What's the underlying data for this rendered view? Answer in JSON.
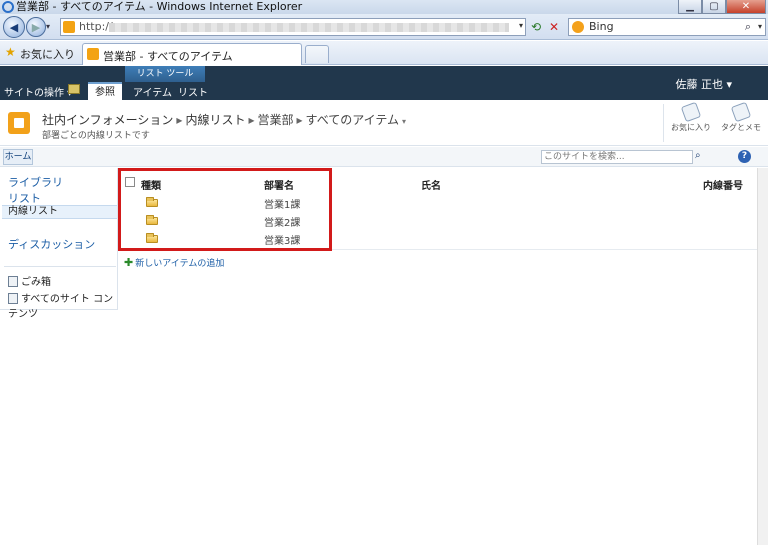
{
  "browser": {
    "window_title": "営業部 - すべてのアイテム - Windows Internet Explorer",
    "url_prefix": "http://",
    "search_provider": "Bing",
    "favorites_label": "お気に入り",
    "tab_title": "営業部 - すべてのアイテム"
  },
  "ribbon": {
    "site_actions": "サイトの操作",
    "browse_tab": "参照",
    "tool_group": "リスト ツール",
    "tool_tabs": [
      "アイテム",
      "リスト"
    ],
    "user": "佐藤 正也"
  },
  "header": {
    "breadcrumb": [
      "社内インフォメーション",
      "内線リスト",
      "営業部",
      "すべてのアイテム"
    ],
    "description": "部署ごとの内線リストです",
    "social": {
      "like": "お気に入り",
      "tags": "タグとメモ"
    }
  },
  "topnav": {
    "home": "ホーム",
    "search_placeholder": "このサイトを検索..."
  },
  "quicklaunch": {
    "items": [
      "ライブラリ",
      "リスト",
      "内線リスト",
      "ディスカッション"
    ],
    "utilities": [
      "ごみ箱",
      "すべてのサイト コンテンツ"
    ]
  },
  "list": {
    "columns": [
      "種類",
      "部署名",
      "氏名",
      "内線番号"
    ],
    "rows": [
      {
        "type": "folder",
        "department": "営業1課"
      },
      {
        "type": "folder",
        "department": "営業2課"
      },
      {
        "type": "folder",
        "department": "営業3課"
      }
    ],
    "add_item": "新しいアイテムの追加"
  },
  "colors": {
    "ribbon_bg": "#21374c",
    "link": "#1c5ea6",
    "highlight": "#d21a1a",
    "logo": "#f2a11a"
  }
}
